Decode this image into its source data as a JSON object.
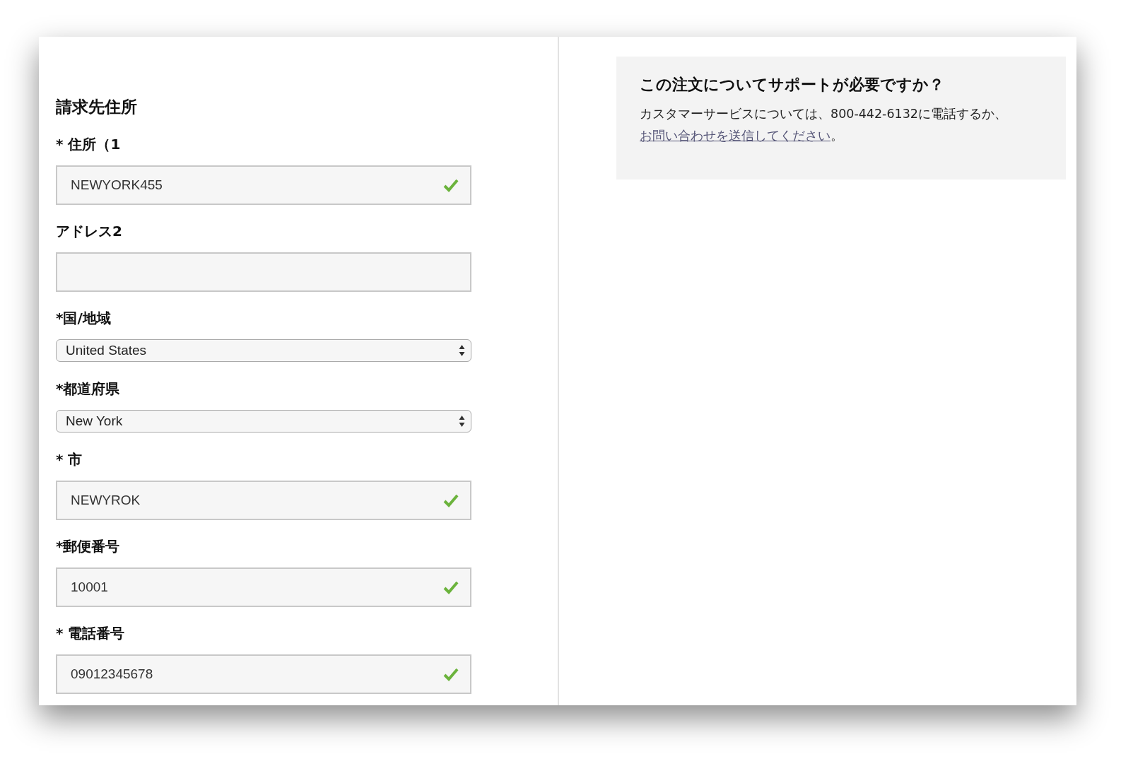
{
  "billing": {
    "title": "請求先住所",
    "fields": [
      {
        "kind": "text",
        "label": "* 住所（1",
        "value": "NEWYORK455",
        "valid": true
      },
      {
        "kind": "text",
        "label": "アドレス2",
        "valid": false
      },
      {
        "kind": "select",
        "label": "*国/地域",
        "value": "United States"
      },
      {
        "kind": "select",
        "label": "*都道府県",
        "value": "New York"
      },
      {
        "kind": "text",
        "label": "* 市",
        "value": "NEWYROK",
        "valid": true
      },
      {
        "kind": "text",
        "label": "*郵便番号",
        "value": "10001",
        "valid": true
      },
      {
        "kind": "text",
        "label": "* 電話番号",
        "value": "09012345678",
        "valid": true
      }
    ]
  },
  "help": {
    "title": "この注文についてサポートが必要ですか？",
    "text": "カスタマーサービスについては、800-442-6132に電話するか、",
    "link": "お問い合わせを送信してください",
    "after": "。"
  }
}
